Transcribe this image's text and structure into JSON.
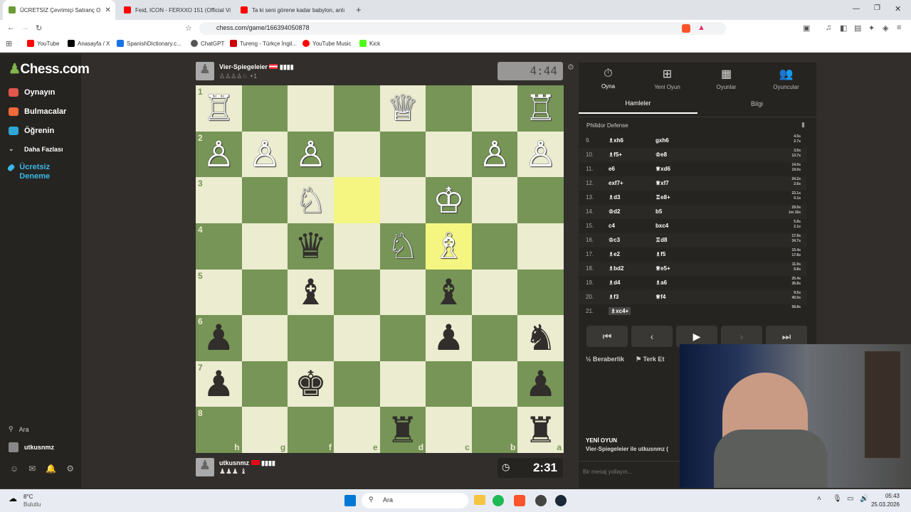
{
  "browser": {
    "tabs": [
      {
        "title": "ÜCRETSİZ Çevrimiçi Satranç O",
        "color": "#6b9b37",
        "active": true
      },
      {
        "title": "Feid, ICON - FERXXO 151 (Official Vi",
        "color": "#ff0000",
        "active": false
      },
      {
        "title": "Ta ki seni görene kadar babylon, anlı",
        "color": "#ff0000",
        "active": false
      }
    ],
    "new_tab": "+",
    "url": "chess.com/game/166394050878",
    "bookmarks": [
      "YouTube",
      "Anasayfa / X",
      "SpanishDictionary.c...",
      "ChatGPT",
      "Tureng - Türkçe İngil...",
      "YouTube Music",
      "Kick"
    ]
  },
  "sidebar": {
    "logo": "Chess.com",
    "items": [
      "Oynayın",
      "Bulmacalar",
      "Öğrenin",
      "Daha Fazlası",
      "Ücretsiz Deneme"
    ],
    "search": "Ara",
    "user": "utkusnmz"
  },
  "game": {
    "top_player": {
      "name": "Vier-Spiegeleier",
      "flag": "AT",
      "bars": "▮▮▮▮",
      "material": "+1",
      "clock": "4:44"
    },
    "bottom_player": {
      "name": "utkusnmz",
      "flag": "TR",
      "bars": "▮▮▮▮",
      "clock": "2:31"
    },
    "ranks": [
      "1",
      "2",
      "3",
      "4",
      "5",
      "6",
      "7",
      "8"
    ],
    "files": [
      "h",
      "g",
      "f",
      "e",
      "d",
      "c",
      "b",
      "a"
    ],
    "board": [
      [
        "♖",
        "",
        "",
        "",
        "♕",
        "",
        "",
        "♖"
      ],
      [
        "♙",
        "♙",
        "♙",
        "",
        "",
        "",
        "♙",
        "♙"
      ],
      [
        "",
        "",
        "♘",
        "",
        "",
        "♔",
        "",
        ""
      ],
      [
        "",
        "",
        "♛",
        "",
        "♘",
        "♗",
        "",
        ""
      ],
      [
        "",
        "",
        "♝",
        "",
        "",
        "♝",
        "",
        ""
      ],
      [
        "♟",
        "",
        "",
        "",
        "",
        "♟",
        "",
        "♞"
      ],
      [
        "♟",
        "",
        "♚",
        "",
        "",
        "",
        "",
        "♟"
      ],
      [
        "",
        "",
        "",
        "",
        "♜",
        "",
        "",
        "♜"
      ]
    ],
    "highlight": [
      "2-3",
      "3-5"
    ]
  },
  "panel": {
    "tabs": [
      {
        "icon": "⏱",
        "label": "Oyna"
      },
      {
        "icon": "⊞",
        "label": "Yeni Oyun"
      },
      {
        "icon": "▦",
        "label": "Oyunlar"
      },
      {
        "icon": "👥",
        "label": "Oyuncular"
      }
    ],
    "subtabs": [
      "Hamleler",
      "Bilgi"
    ],
    "opening": "Philidor Defense",
    "moves": [
      {
        "n": "9.",
        "w": "♗xh6",
        "b": "gxh6",
        "t": "4.5s\n2.7s"
      },
      {
        "n": "10.",
        "w": "♗f5+",
        "b": "♔e8",
        "t": "3.5s\n13.7s"
      },
      {
        "n": "11.",
        "w": "e6",
        "b": "♕xd6",
        "t": "14.0s\n19.0s"
      },
      {
        "n": "12.",
        "w": "exf7+",
        "b": "♕xf7",
        "t": "24.2s\n2.6s"
      },
      {
        "n": "13.",
        "w": "♗d3",
        "b": "♖e8+",
        "t": "23.1s\n0.1s"
      },
      {
        "n": "14.",
        "w": "♔d2",
        "b": "b5",
        "t": "29.0s\n1m 16s"
      },
      {
        "n": "15.",
        "w": "c4",
        "b": "bxc4",
        "t": "5.8s\n2.1s"
      },
      {
        "n": "16.",
        "w": "♔c3",
        "b": "♖d8",
        "t": "17.9s\n34.7s"
      },
      {
        "n": "17.",
        "w": "♗e2",
        "b": "♗f5",
        "t": "15.4s\n17.8s"
      },
      {
        "n": "18.",
        "w": "♗bd2",
        "b": "♕e5+",
        "t": "11.0s\n5.8s"
      },
      {
        "n": "19.",
        "w": "♗d4",
        "b": "♗a6",
        "t": "25.4s\n36.8s"
      },
      {
        "n": "20.",
        "w": "♗f3",
        "b": "♕f4",
        "t": "9.5s\n40.0s"
      },
      {
        "n": "21.",
        "w": "♗xc4+",
        "b": "",
        "t": "58.8s"
      }
    ],
    "controls": [
      "⏮",
      "‹",
      "▶",
      "›",
      "⏭"
    ],
    "draw": "Beraberlik",
    "resign": "Terk Et",
    "new_game_title": "YENİ OYUN",
    "new_game_text": "Vier-Spiegeleier ile utkusnmz (",
    "chat_placeholder": "Bir mesaj yollayın..."
  },
  "taskbar": {
    "weather_temp": "8°C",
    "weather_text": "Bulutlu",
    "search": "Ara",
    "time": "05:43",
    "date": "25.03.2026"
  }
}
